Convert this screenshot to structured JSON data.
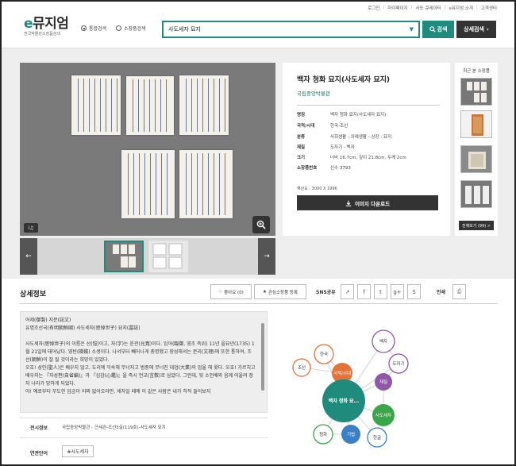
{
  "util_links": [
    "로그인",
    "마이페이지",
    "사또 큐레이터",
    "e뮤지엄 소개",
    "고객센터"
  ],
  "logo": {
    "title_e": "e",
    "title_rest": "뮤지엄",
    "subtitle": "전국박물관소장품검색"
  },
  "search": {
    "scope_options": [
      "통합검색",
      "소장품검색"
    ],
    "selected_scope": "통합검색",
    "query": "사도세자 묘지",
    "search_label": "검색",
    "advanced_label": "상세검색"
  },
  "artifact": {
    "title": "백자 청화 묘지(사도세자 묘지)",
    "museum": "국립중앙박물관",
    "meta": [
      {
        "key": "명칭",
        "value": "백자 청화 묘지(사도세자 묘지)"
      },
      {
        "key": "국적/시대",
        "value": "한국-조선"
      },
      {
        "key": "분류",
        "value": "사회생활 - 의례생활 - 상장 - 묘지"
      },
      {
        "key": "재질",
        "value": "도자기 - 백자"
      },
      {
        "key": "크기",
        "value": "너비 16.7cm, 깊이 21.8cm, 두께 2cm"
      },
      {
        "key": "소장품번호",
        "value": "신수 3793"
      }
    ],
    "resolution": "해상도 : 3000 X 1996",
    "download_label": "이미지 다운로드"
  },
  "viewer": {
    "badge": "ⅰ♫",
    "zoom_icon": "magnifier-plus-icon"
  },
  "recent": {
    "title": "최근 본 소장품",
    "more_label": "전체보기 (99) >"
  },
  "detail": {
    "title": "상세정보",
    "like_label": "좋아요 (0)",
    "fav_label": "관심소장품 등록",
    "sns_label": "SNS공유",
    "print_label": "인쇄",
    "text": [
      "어제(御製) 지문(誌文)",
      "유명조선국(有明朝鮮國) 사도세자(思悼世子) 묘지(墓誌)",
      "",
      "사도세자(思悼世子)의 이름은 선(愃)이고, 자(字)는 윤관(允寬)이다. 임어(臨御, 영조 즉위) 11년 을묘년(1735) 1월 21일에 태어났다. 영빈(暎嬪) 소생이다. 나서부터 빼어나게 총명했고 장성해서는 문리(文理)에 또한 통하여, 조선(朝鮮)이 잘 될 것이라는 희망이 있었다.",
      "오호! 성인(聖人)은 배우지 않고, 도리에 익숙해 무너지고 범중에 무너진 대업(大業)의 암울 해 왔다. 오호! 가르치고 배우지는 『자성편(自省編)』과 『심감(心鑑)』을 즉시 언교(言敎)로 삼았다. 그런데, 뒷 소인배와 음께 어울려 장자 나라가 망하게 되었다.",
      "아! 예로부터 무도한 임금이 어찌 없어오라만, 세자일 때에 이 같은 사람은 내가 하직 들어보지"
    ],
    "exhibition_label": "전시정보",
    "exhibition_value": "국립중앙박물관 - 근세관-조선3실(119호)-사도세자 묘지",
    "related_label": "연관단어",
    "related_tag": "#사도세자"
  },
  "graph": {
    "center": "백자 청화 묘...",
    "nodes": [
      "한국",
      "국적/시대",
      "조선",
      "도자기",
      "백자",
      "재질",
      "청화",
      "기법",
      "한글",
      "사도세자"
    ]
  },
  "colors": {
    "accent": "#1e8b7d",
    "dark": "#333333",
    "node_orange": "#e2733a",
    "node_purple": "#8e57a8",
    "node_blue": "#3b7fc4",
    "node_green": "#3aa64a"
  }
}
